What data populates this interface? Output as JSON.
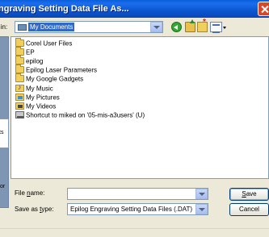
{
  "window": {
    "title": "ngraving Setting Data File As..."
  },
  "lookin": {
    "label": "e in:",
    "value": "My Documents"
  },
  "places": {
    "text_a": "ts",
    "text_b": "or"
  },
  "files": [
    {
      "name": "Corel User Files",
      "icon": "folder-icon"
    },
    {
      "name": "EP",
      "icon": "folder-icon"
    },
    {
      "name": "epilog",
      "icon": "folder-icon"
    },
    {
      "name": "Epilog Laser Parameters",
      "icon": "folder-icon"
    },
    {
      "name": "My Google Gadgets",
      "icon": "folder-icon"
    },
    {
      "name": "My Music",
      "icon": "music-folder-icon"
    },
    {
      "name": "My Pictures",
      "icon": "pictures-folder-icon"
    },
    {
      "name": "My Videos",
      "icon": "videos-folder-icon"
    },
    {
      "name": "Shortcut to miked on '05-mis-a3users' (U)",
      "icon": "network-drive-icon"
    }
  ],
  "filename": {
    "label_pre": "File ",
    "label_u": "n",
    "label_post": "ame:",
    "value": ""
  },
  "savetype": {
    "label_pre": "Save as ",
    "label_u": "t",
    "label_post": "ype:",
    "value": "Epilog Engraving Setting Data Files (.DAT)"
  },
  "buttons": {
    "save_pre": "",
    "save_u": "S",
    "save_post": "ave",
    "cancel": "Cancel"
  }
}
